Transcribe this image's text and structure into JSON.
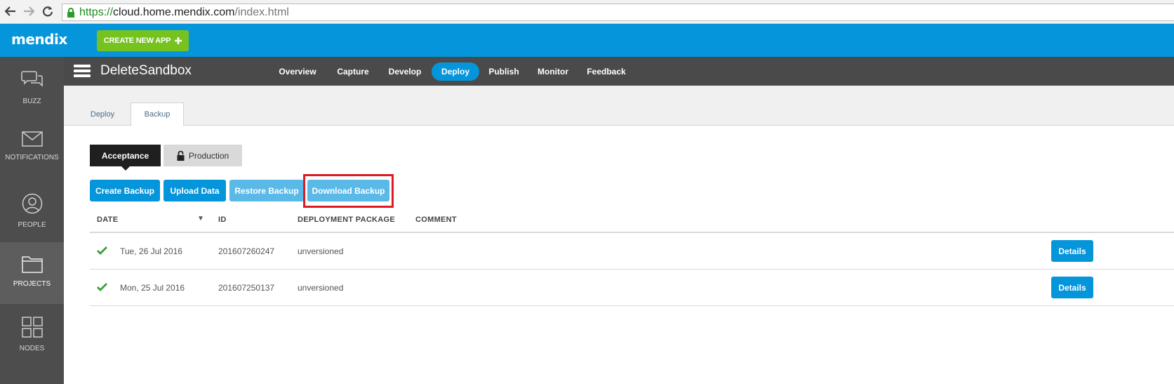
{
  "browser": {
    "url_protocol": "https://",
    "url_host": "cloud.home.mendix.com",
    "url_path": "/index.html"
  },
  "header": {
    "logo": "mendix",
    "create_app_label": "CREATE NEW APP"
  },
  "sidebar": {
    "items": [
      {
        "label": "BUZZ",
        "icon": "chat-bubbles-icon"
      },
      {
        "label": "NOTIFICATIONS",
        "icon": "envelope-icon"
      },
      {
        "label": "PEOPLE",
        "icon": "person-icon"
      },
      {
        "label": "PROJECTS",
        "icon": "folder-icon"
      },
      {
        "label": "NODES",
        "icon": "grid-icon"
      }
    ],
    "active": "PROJECTS"
  },
  "appbar": {
    "title": "DeleteSandbox",
    "nav": [
      "Overview",
      "Capture",
      "Develop",
      "Deploy",
      "Publish",
      "Monitor",
      "Feedback"
    ],
    "active": "Deploy"
  },
  "subtabs": {
    "items": [
      "Deploy",
      "Backup"
    ],
    "active": "Backup"
  },
  "environments": {
    "acceptance": "Acceptance",
    "production": "Production",
    "active": "Acceptance"
  },
  "actions": {
    "create": "Create Backup",
    "upload": "Upload Data",
    "restore": "Restore Backup",
    "download": "Download Backup"
  },
  "table": {
    "headers": [
      "DATE",
      "ID",
      "DEPLOYMENT PACKAGE",
      "COMMENT"
    ],
    "rows": [
      {
        "date": "Tue, 26 Jul 2016",
        "id": "201607260247",
        "package": "unversioned",
        "comment": "",
        "action": "Details"
      },
      {
        "date": "Mon, 25 Jul 2016",
        "id": "201607250137",
        "package": "unversioned",
        "comment": "",
        "action": "Details"
      }
    ]
  },
  "colors": {
    "brand_blue": "#0595db",
    "create_green": "#76c21f",
    "highlight_red": "#e01a22"
  }
}
